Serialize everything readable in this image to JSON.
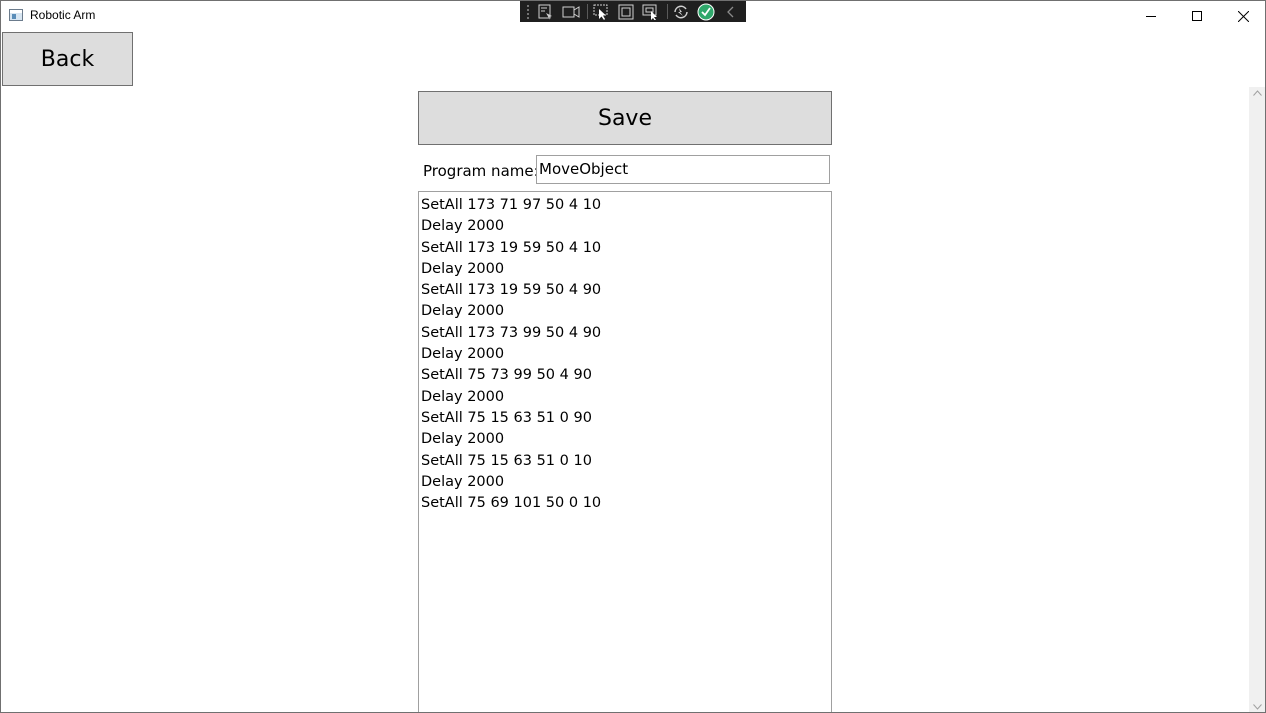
{
  "window": {
    "title": "Robotic Arm"
  },
  "toolbar": {
    "back_label": "Back",
    "save_label": "Save"
  },
  "program": {
    "name_label": "Program name:",
    "name_value": "MoveObject"
  },
  "code_lines": [
    "SetAll 173 71 97 50 4 10",
    "Delay 2000",
    "SetAll 173 19 59 50 4 10",
    "Delay 2000",
    "SetAll 173 19 59 50 4 90",
    "Delay 2000",
    "SetAll 173 73 99 50 4 90",
    "Delay 2000",
    "SetAll 75 73 99 50 4 90",
    "Delay 2000",
    "SetAll 75 15 63 51 0 90",
    "Delay 2000",
    "SetAll 75 15 63 51 0 10",
    "Delay 2000",
    "SetAll 75 69 101 50 0 10"
  ],
  "colors": {
    "button_bg": "#dddddd",
    "button_border": "#707070",
    "debug_toolbar_bg": "#1f1f1f",
    "check_green": "#22a06b"
  },
  "icons": {
    "debug_toolbar": [
      "live-visual-tree-icon",
      "camera-icon",
      "select-element-icon",
      "display-layout-adorners-icon",
      "track-focused-element-icon",
      "hot-reload-icon",
      "binding-check-icon",
      "collapse-toolbar-icon"
    ]
  }
}
